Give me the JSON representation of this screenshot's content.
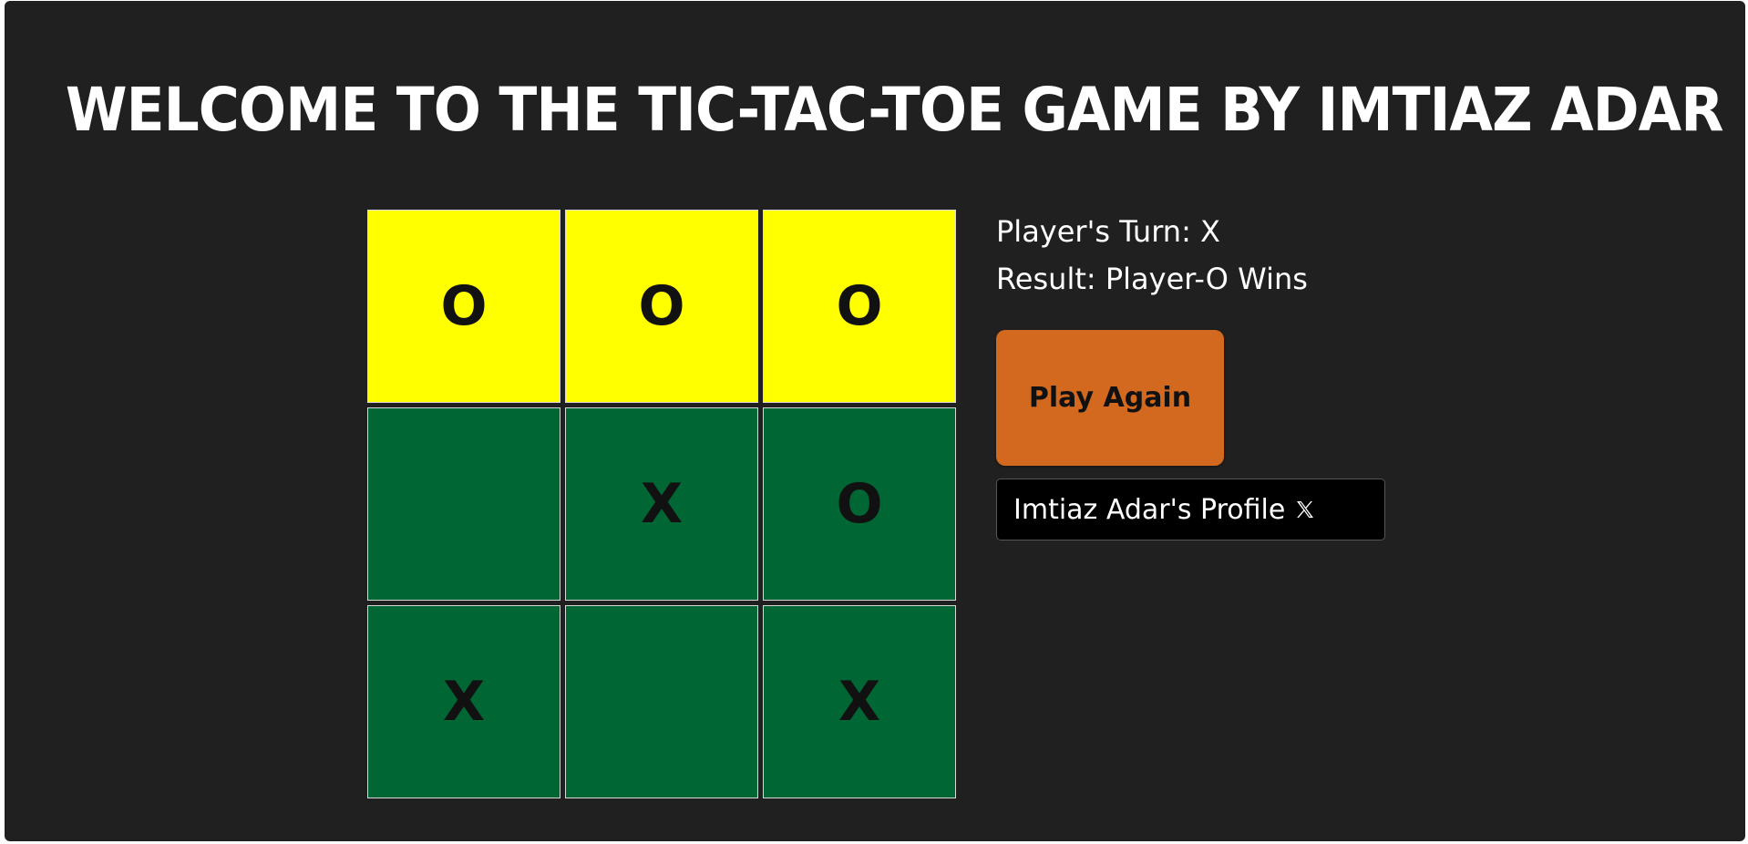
{
  "header": {
    "title": "WELCOME TO THE TIC-TAC-TOE GAME BY IMTIAZ ADAR"
  },
  "board": {
    "cells": [
      "O",
      "O",
      "O",
      "",
      "X",
      "O",
      "X",
      "",
      "X"
    ],
    "winning_cells": [
      0,
      1,
      2
    ],
    "colors": {
      "cell": "#006633",
      "winning_cell": "#ffff00"
    }
  },
  "status": {
    "turn": "Player's Turn: X",
    "result": "Result: Player-O Wins"
  },
  "actions": {
    "play_again_label": "Play Again",
    "profile_label": "Imtiaz Adar's Profile",
    "profile_icon": "x-logo-icon"
  },
  "colors": {
    "background": "#202020",
    "play_again": "#d2691e",
    "profile_button": "#000000"
  }
}
